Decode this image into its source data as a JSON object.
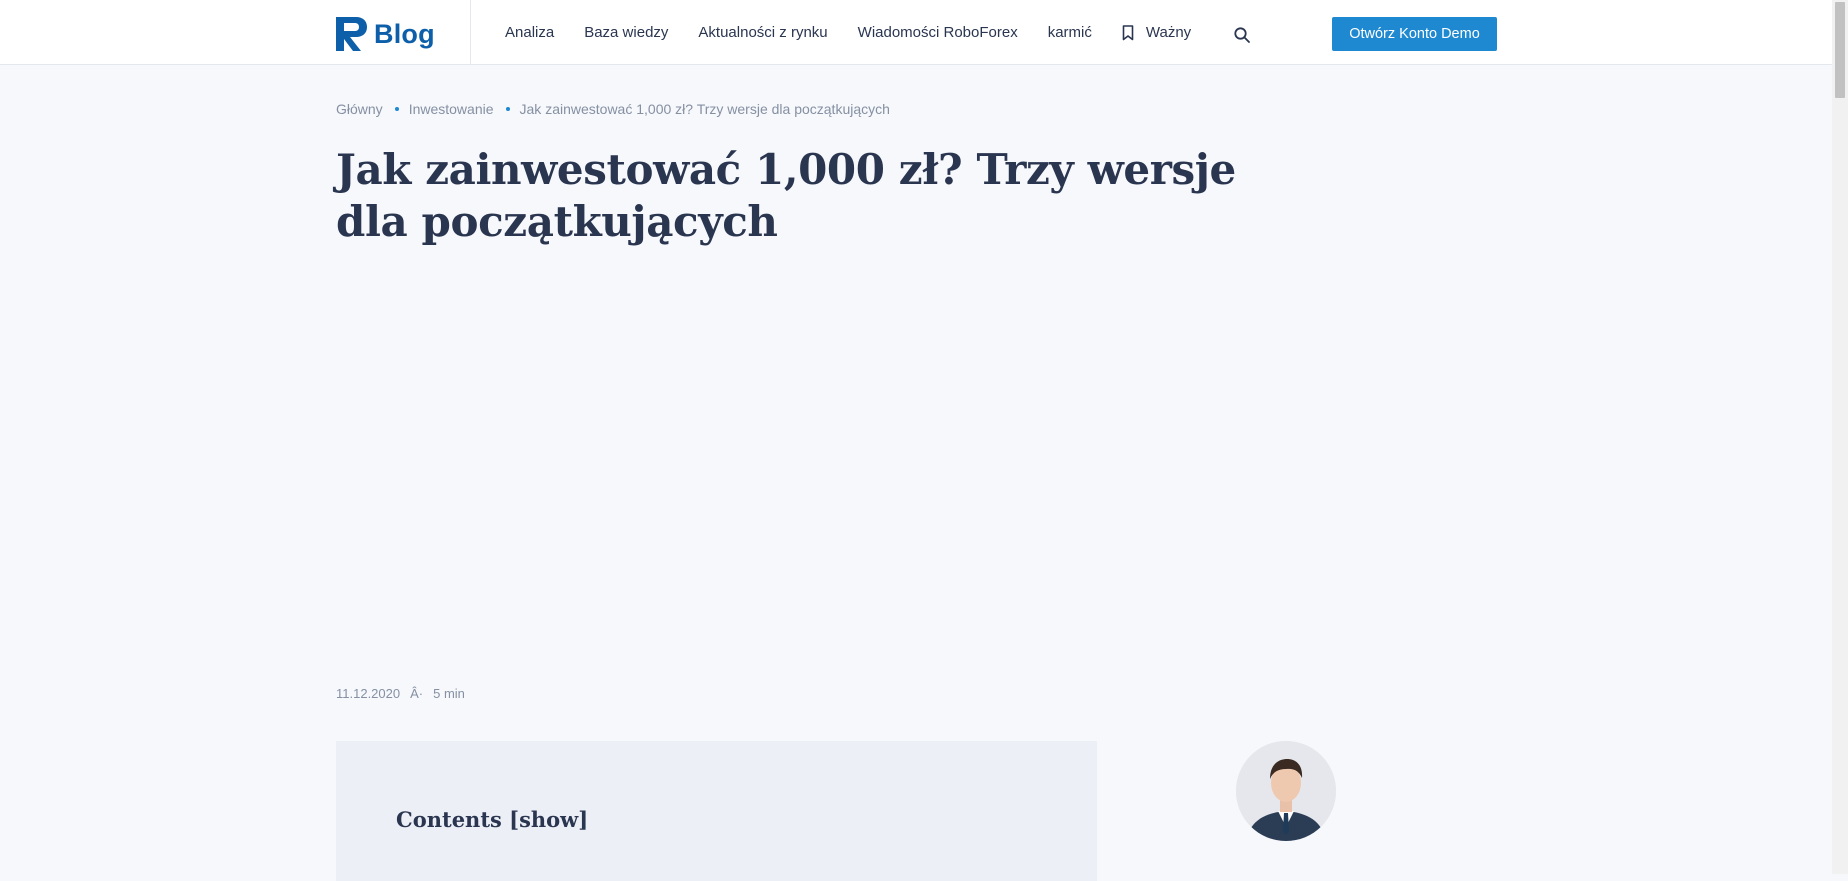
{
  "header": {
    "logo_text": "Blog",
    "nav": [
      {
        "label": "Analiza"
      },
      {
        "label": "Baza wiedzy"
      },
      {
        "label": "Aktualności z rynku"
      },
      {
        "label": "Wiadomości RoboForex"
      },
      {
        "label": "karmić"
      },
      {
        "label": "Ważny"
      }
    ],
    "demo_button": "Otwórz Konto Demo"
  },
  "breadcrumb": {
    "items": [
      "Główny",
      "Inwestowanie",
      "Jak zainwestować 1,000 zł? Trzy wersje dla początkujących"
    ]
  },
  "article": {
    "title": "Jak zainwestować 1,000 zł? Trzy wersje dla początkujących",
    "date": "11.12.2020",
    "separator": "Â·",
    "read_time": "5 min"
  },
  "contents": {
    "title": "Contents [show]"
  },
  "colors": {
    "brand": "#0c5fa8",
    "accent": "#1e88d0",
    "text": "#2a3550",
    "muted": "#8590a3",
    "background": "#f6f8fb"
  },
  "icons": {
    "logo": "roboforex-logo-icon",
    "bookmark": "bookmark-icon",
    "search": "search-icon"
  }
}
